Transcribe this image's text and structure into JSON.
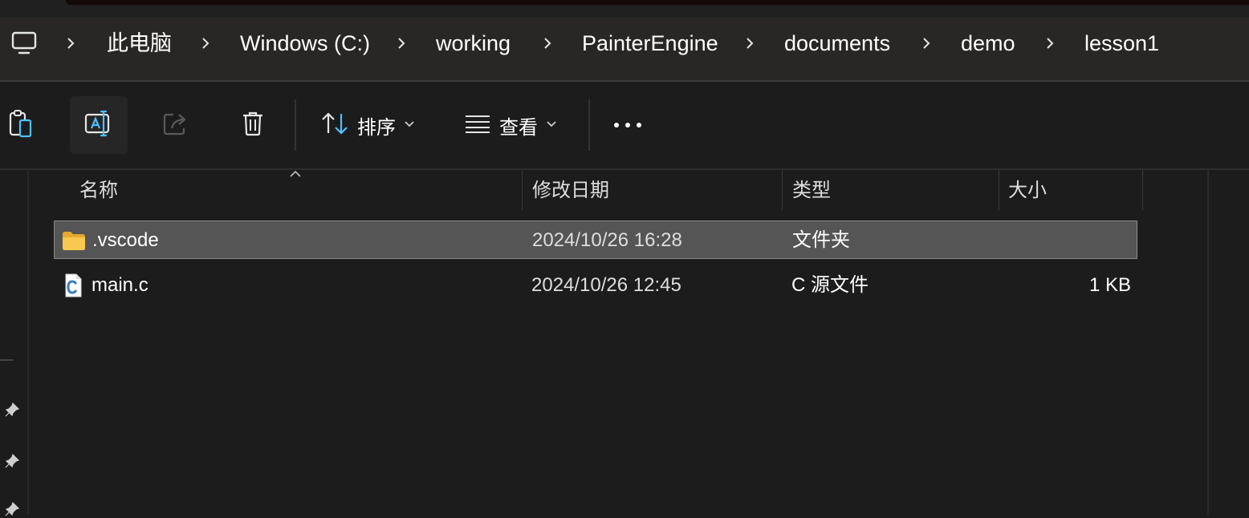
{
  "address_bar": {
    "root_icon": "monitor-icon",
    "separator_icon": "chevron-right-icon",
    "crumbs": [
      "此电脑",
      "Windows (C:)",
      "working",
      "PainterEngine",
      "documents",
      "demo",
      "lesson1"
    ]
  },
  "toolbar": {
    "paste_icon": "clipboard-icon",
    "rename_icon": "rename-icon",
    "share_icon": "share-icon",
    "delete_icon": "trash-icon",
    "sort_label": "排序",
    "view_label": "查看",
    "more_icon": "more-icon"
  },
  "columns": {
    "name": "名称",
    "modified": "修改日期",
    "type": "类型",
    "size": "大小"
  },
  "files": [
    {
      "name": ".vscode",
      "modified": "2024/10/26 16:28",
      "type": "文件夹",
      "size": "",
      "icon": "folder-icon",
      "selected": true
    },
    {
      "name": "main.c",
      "modified": "2024/10/26 12:45",
      "type": "C 源文件",
      "size": "1 KB",
      "icon": "c-file-icon",
      "selected": false
    }
  ],
  "colors": {
    "background": "#1c1c1c",
    "address_bar": "#2b2626",
    "selection": "#555555",
    "accent_blue": "#4cc2ff",
    "folder_yellow": "#f8c94e"
  }
}
